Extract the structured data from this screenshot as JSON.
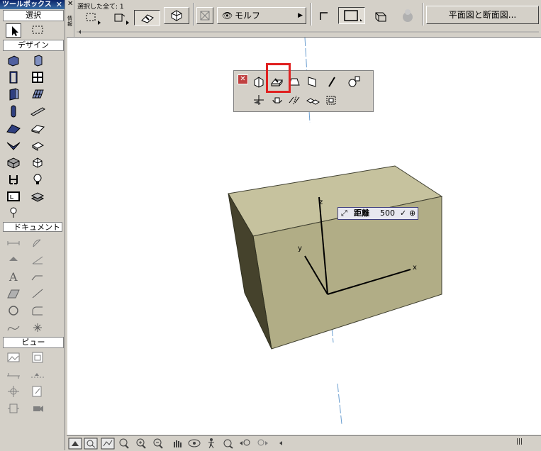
{
  "toolbox": {
    "title": "ツールボックス",
    "close_glyph": "✕",
    "section_select": "選択",
    "section_design": "デザイン",
    "section_document": "ドキュメント",
    "section_view": "ビュー"
  },
  "infobox": {
    "close_glyph": "✕",
    "panel_label": "情報",
    "selection_info": "選択した全て: 1",
    "morph_label": "モルフ",
    "section_button_label": "平面図と断面図..."
  },
  "distance": {
    "label": "距離",
    "value": "500",
    "ok_glyph": "✓",
    "option_glyph": "⊕"
  },
  "axes": {
    "x": "x",
    "y": "y",
    "z": "z"
  },
  "colors": {
    "box_top": "#c6c29e",
    "box_front": "#b1ad86",
    "box_side": "#45422c",
    "highlight": "#e02020",
    "title_bar": "#0a246a"
  }
}
